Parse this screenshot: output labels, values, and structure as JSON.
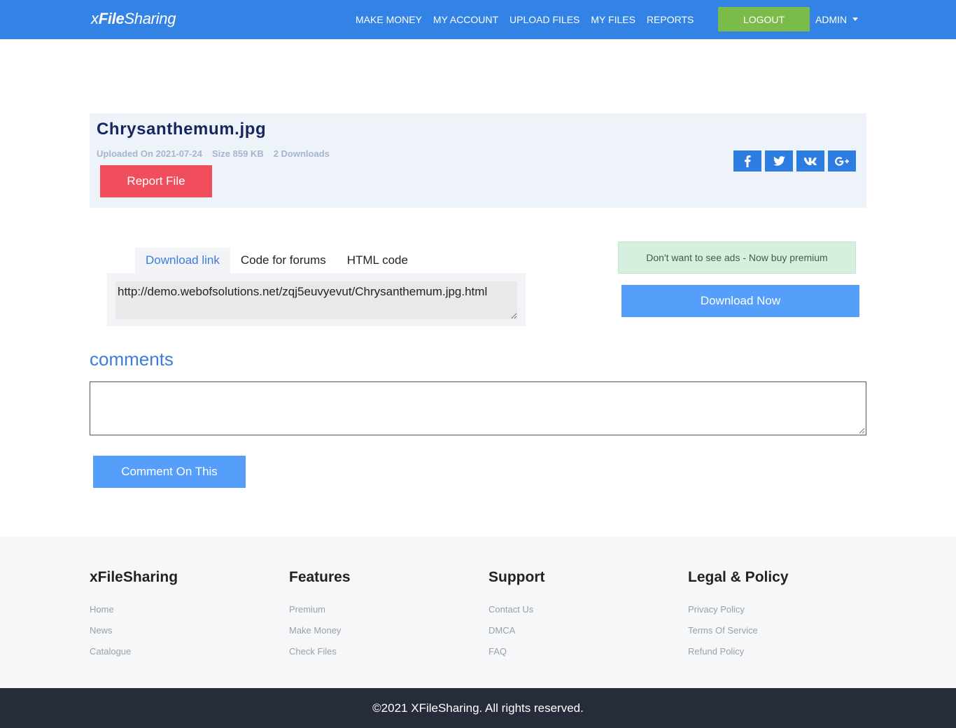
{
  "navbar": {
    "brand_prefix": "x",
    "brand_bold": "File",
    "brand_suffix": "Sharing",
    "links": [
      "MAKE MONEY",
      "MY ACCOUNT",
      "UPLOAD FILES",
      "MY FILES",
      "REPORTS"
    ],
    "logout_label": "LOGOUT",
    "admin_label": "ADMIN",
    "bg_color": "#3382e6",
    "logout_color": "#7abb4a"
  },
  "file": {
    "title": "Chrysanthemum.jpg",
    "uploaded": "Uploaded On 2021-07-24",
    "size": "Size 859 KB",
    "downloads": "2 Downloads",
    "report_label": "Report File",
    "share_icons": [
      "facebook-icon",
      "twitter-icon",
      "vk-icon",
      "google-plus-icon"
    ]
  },
  "link_tabs": {
    "tabs": [
      "Download link",
      "Code for forums",
      "HTML code"
    ],
    "active": "Download link",
    "value": "http://demo.webofsolutions.net/zqj5euvyevut/Chrysanthemum.jpg.html"
  },
  "sidebar": {
    "premium_text": "Don't want to see ads - Now buy premium",
    "download_label": "Download Now"
  },
  "comments": {
    "heading": "comments",
    "button_label": "Comment On This"
  },
  "footer": {
    "columns": [
      {
        "title": "xFileSharing",
        "links": [
          "Home",
          "News",
          "Catalogue"
        ]
      },
      {
        "title": "Features",
        "links": [
          "Premium",
          "Make Money",
          "Check Files"
        ]
      },
      {
        "title": "Support",
        "links": [
          "Contact Us",
          "DMCA",
          "FAQ"
        ]
      },
      {
        "title": "Legal & Policy",
        "links": [
          "Privacy Policy",
          "Terms Of Service",
          "Refund Policy"
        ]
      }
    ],
    "copyright": "©2021 XFileSharing. All rights reserved."
  }
}
